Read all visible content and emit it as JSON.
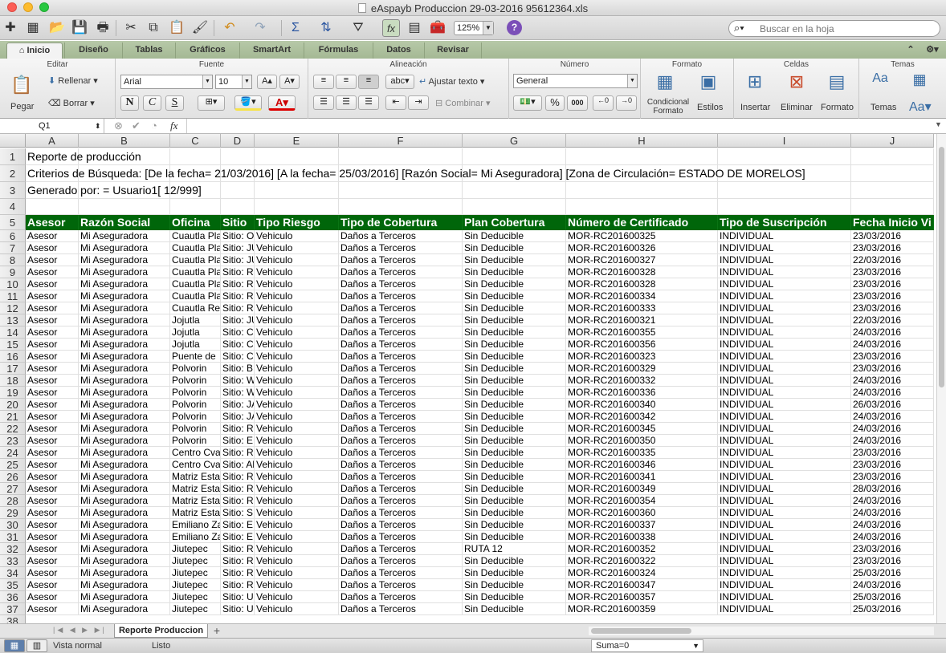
{
  "window": {
    "title": "eAspayb Produccion 29-03-2016 95612364.xls"
  },
  "toolbar": {
    "zoom": "125%",
    "search_placeholder": "Buscar en la hoja",
    "help": "?"
  },
  "tabs": [
    "Inicio",
    "Diseño",
    "Tablas",
    "Gráficos",
    "SmartArt",
    "Fórmulas",
    "Datos",
    "Revisar"
  ],
  "ribbon": {
    "groups": {
      "editar": "Editar",
      "fuente": "Fuente",
      "alineacion": "Alineación",
      "numero": "Número",
      "formato": "Formato",
      "celdas": "Celdas",
      "temas": "Temas"
    },
    "pegar": "Pegar",
    "rellenar": "Rellenar",
    "borrar": "Borrar",
    "font_name": "Arial",
    "font_size": "10",
    "bold": "N",
    "italic": "C",
    "underline": "S",
    "abc": "abc",
    "ajustar": "Ajustar texto",
    "combinar": "Combinar",
    "number_format": "General",
    "percent": "%",
    "thousands": "000",
    "cond_format_1": "Condicional",
    "cond_format_2": "Formato",
    "estilos": "Estilos",
    "insertar": "Insertar",
    "eliminar": "Eliminar",
    "formato_btn": "Formato",
    "temas_btn": "Temas",
    "aa": "Aa"
  },
  "formula_bar": {
    "cell_ref": "Q1",
    "fx": "fx"
  },
  "columns": [
    "A",
    "B",
    "C",
    "D",
    "E",
    "F",
    "G",
    "H",
    "I",
    "J"
  ],
  "rows": {
    "r1": "Reporte de producción",
    "r2": "Criterios de Búsqueda: [De la fecha= 21/03/2016] [A la fecha= 25/03/2016] [Razón Social= Mi Aseguradora] [Zona de Circulación= ESTADO DE MORELOS]",
    "r3": "Generado por: = Usuario1[ 12/999]"
  },
  "table": {
    "headers": [
      "Asesor",
      "Razón Social",
      "Oficina",
      "Sitio",
      "Tipo Riesgo",
      "Tipo de Cobertura",
      "Plan Cobertura",
      "Número de Certificado",
      "Tipo de Suscripción",
      "Fecha Inicio Vi"
    ],
    "rows": [
      [
        "Asesor",
        "Mi Aseguradora",
        "Cuautla Pla",
        "Sitio: O",
        "Vehiculo",
        "Daños a Terceros",
        "Sin Deducible",
        "MOR-RC201600325",
        "INDIVIDUAL",
        "23/03/2016"
      ],
      [
        "Asesor",
        "Mi Aseguradora",
        "Cuautla Pla",
        "Sitio: JU",
        "Vehiculo",
        "Daños a Terceros",
        "Sin Deducible",
        "MOR-RC201600326",
        "INDIVIDUAL",
        "23/03/2016"
      ],
      [
        "Asesor",
        "Mi Aseguradora",
        "Cuautla Pla",
        "Sitio: JU",
        "Vehiculo",
        "Daños a Terceros",
        "Sin Deducible",
        "MOR-RC201600327",
        "INDIVIDUAL",
        "22/03/2016"
      ],
      [
        "Asesor",
        "Mi Aseguradora",
        "Cuautla Pla",
        "Sitio: R",
        "Vehiculo",
        "Daños a Terceros",
        "Sin Deducible",
        "MOR-RC201600328",
        "INDIVIDUAL",
        "23/03/2016"
      ],
      [
        "Asesor",
        "Mi Aseguradora",
        "Cuautla Pla",
        "Sitio: R",
        "Vehiculo",
        "Daños a Terceros",
        "Sin Deducible",
        "MOR-RC201600328",
        "INDIVIDUAL",
        "23/03/2016"
      ],
      [
        "Asesor",
        "Mi Aseguradora",
        "Cuautla Pla",
        "Sitio: R",
        "Vehiculo",
        "Daños a Terceros",
        "Sin Deducible",
        "MOR-RC201600334",
        "INDIVIDUAL",
        "23/03/2016"
      ],
      [
        "Asesor",
        "Mi Aseguradora",
        "Cuautla Re",
        "Sitio: R",
        "Vehiculo",
        "Daños a Terceros",
        "Sin Deducible",
        "MOR-RC201600333",
        "INDIVIDUAL",
        "23/03/2016"
      ],
      [
        "Asesor",
        "Mi Aseguradora",
        "Jojutla",
        "Sitio: JU",
        "Vehiculo",
        "Daños a Terceros",
        "Sin Deducible",
        "MOR-RC201600321",
        "INDIVIDUAL",
        "22/03/2016"
      ],
      [
        "Asesor",
        "Mi Aseguradora",
        "Jojutla",
        "Sitio: C",
        "Vehiculo",
        "Daños a Terceros",
        "Sin Deducible",
        "MOR-RC201600355",
        "INDIVIDUAL",
        "24/03/2016"
      ],
      [
        "Asesor",
        "Mi Aseguradora",
        "Jojutla",
        "Sitio: C",
        "Vehiculo",
        "Daños a Terceros",
        "Sin Deducible",
        "MOR-RC201600356",
        "INDIVIDUAL",
        "24/03/2016"
      ],
      [
        "Asesor",
        "Mi Aseguradora",
        "Puente de",
        "Sitio: C",
        "Vehiculo",
        "Daños a Terceros",
        "Sin Deducible",
        "MOR-RC201600323",
        "INDIVIDUAL",
        "23/03/2016"
      ],
      [
        "Asesor",
        "Mi Aseguradora",
        "Polvorin",
        "Sitio: B",
        "Vehiculo",
        "Daños a Terceros",
        "Sin Deducible",
        "MOR-RC201600329",
        "INDIVIDUAL",
        "23/03/2016"
      ],
      [
        "Asesor",
        "Mi Aseguradora",
        "Polvorin",
        "Sitio: W",
        "Vehiculo",
        "Daños a Terceros",
        "Sin Deducible",
        "MOR-RC201600332",
        "INDIVIDUAL",
        "24/03/2016"
      ],
      [
        "Asesor",
        "Mi Aseguradora",
        "Polvorin",
        "Sitio: W",
        "Vehiculo",
        "Daños a Terceros",
        "Sin Deducible",
        "MOR-RC201600336",
        "INDIVIDUAL",
        "24/03/2016"
      ],
      [
        "Asesor",
        "Mi Aseguradora",
        "Polvorin",
        "Sitio: JA",
        "Vehiculo",
        "Daños a Terceros",
        "Sin Deducible",
        "MOR-RC201600340",
        "INDIVIDUAL",
        "26/03/2016"
      ],
      [
        "Asesor",
        "Mi Aseguradora",
        "Polvorin",
        "Sitio: JA",
        "Vehiculo",
        "Daños a Terceros",
        "Sin Deducible",
        "MOR-RC201600342",
        "INDIVIDUAL",
        "24/03/2016"
      ],
      [
        "Asesor",
        "Mi Aseguradora",
        "Polvorin",
        "Sitio: R",
        "Vehiculo",
        "Daños a Terceros",
        "Sin Deducible",
        "MOR-RC201600345",
        "INDIVIDUAL",
        "24/03/2016"
      ],
      [
        "Asesor",
        "Mi Aseguradora",
        "Polvorin",
        "Sitio: E",
        "Vehiculo",
        "Daños a Terceros",
        "Sin Deducible",
        "MOR-RC201600350",
        "INDIVIDUAL",
        "24/03/2016"
      ],
      [
        "Asesor",
        "Mi Aseguradora",
        "Centro Cva",
        "Sitio: R",
        "Vehiculo",
        "Daños a Terceros",
        "Sin Deducible",
        "MOR-RC201600335",
        "INDIVIDUAL",
        "23/03/2016"
      ],
      [
        "Asesor",
        "Mi Aseguradora",
        "Centro Cva",
        "Sitio: Al",
        "Vehiculo",
        "Daños a Terceros",
        "Sin Deducible",
        "MOR-RC201600346",
        "INDIVIDUAL",
        "23/03/2016"
      ],
      [
        "Asesor",
        "Mi Aseguradora",
        "Matriz Esta",
        "Sitio: R",
        "Vehiculo",
        "Daños a Terceros",
        "Sin Deducible",
        "MOR-RC201600341",
        "INDIVIDUAL",
        "23/03/2016"
      ],
      [
        "Asesor",
        "Mi Aseguradora",
        "Matriz Esta",
        "Sitio: R",
        "Vehiculo",
        "Daños a Terceros",
        "Sin Deducible",
        "MOR-RC201600349",
        "INDIVIDUAL",
        "28/03/2016"
      ],
      [
        "Asesor",
        "Mi Aseguradora",
        "Matriz Esta",
        "Sitio: R",
        "Vehiculo",
        "Daños a Terceros",
        "Sin Deducible",
        "MOR-RC201600354",
        "INDIVIDUAL",
        "24/03/2016"
      ],
      [
        "Asesor",
        "Mi Aseguradora",
        "Matriz Esta",
        "Sitio: S",
        "Vehiculo",
        "Daños a Terceros",
        "Sin Deducible",
        "MOR-RC201600360",
        "INDIVIDUAL",
        "24/03/2016"
      ],
      [
        "Asesor",
        "Mi Aseguradora",
        "Emiliano Za",
        "Sitio: E",
        "Vehiculo",
        "Daños a Terceros",
        "Sin Deducible",
        "MOR-RC201600337",
        "INDIVIDUAL",
        "24/03/2016"
      ],
      [
        "Asesor",
        "Mi Aseguradora",
        "Emiliano Za",
        "Sitio: E",
        "Vehiculo",
        "Daños a Terceros",
        "Sin Deducible",
        "MOR-RC201600338",
        "INDIVIDUAL",
        "24/03/2016"
      ],
      [
        "Asesor",
        "Mi Aseguradora",
        "Jiutepec",
        "Sitio: R",
        "Vehiculo",
        "Daños a Terceros",
        "RUTA 12",
        "MOR-RC201600352",
        "INDIVIDUAL",
        "23/03/2016"
      ],
      [
        "Asesor",
        "Mi Aseguradora",
        "Jiutepec",
        "Sitio: R",
        "Vehiculo",
        "Daños a Terceros",
        "Sin Deducible",
        "MOR-RC201600322",
        "INDIVIDUAL",
        "23/03/2016"
      ],
      [
        "Asesor",
        "Mi Aseguradora",
        "Jiutepec",
        "Sitio: R",
        "Vehiculo",
        "Daños a Terceros",
        "Sin Deducible",
        "MOR-RC201600324",
        "INDIVIDUAL",
        "25/03/2016"
      ],
      [
        "Asesor",
        "Mi Aseguradora",
        "Jiutepec",
        "Sitio: R",
        "Vehiculo",
        "Daños a Terceros",
        "Sin Deducible",
        "MOR-RC201600347",
        "INDIVIDUAL",
        "24/03/2016"
      ],
      [
        "Asesor",
        "Mi Aseguradora",
        "Jiutepec",
        "Sitio: U",
        "Vehiculo",
        "Daños a Terceros",
        "Sin Deducible",
        "MOR-RC201600357",
        "INDIVIDUAL",
        "25/03/2016"
      ],
      [
        "Asesor",
        "Mi Aseguradora",
        "Jiutepec",
        "Sitio: U",
        "Vehiculo",
        "Daños a Terceros",
        "Sin Deducible",
        "MOR-RC201600359",
        "INDIVIDUAL",
        "25/03/2016"
      ]
    ]
  },
  "sheet_tab": "Reporte Produccion",
  "add_sheet": "+",
  "status": {
    "view": "Vista normal",
    "ready": "Listo",
    "sum": "Suma=0"
  },
  "colors": {
    "header_bg": "#00660a",
    "header_text": "#ffffff",
    "ribbon_tabs": "#a8bb98"
  }
}
